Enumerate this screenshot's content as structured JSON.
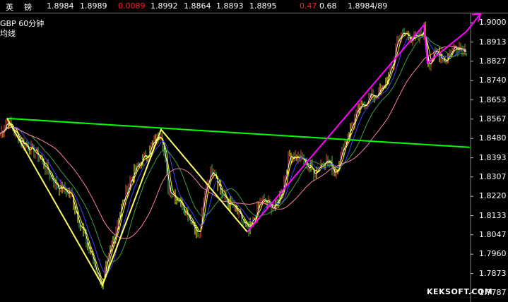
{
  "ticker": {
    "name_1": "英",
    "name_2": "镑",
    "last": "1.8984",
    "ask": "1.8989",
    "change": "0.0089",
    "open": "1.8992",
    "low": "1.8864",
    "prev": "1.8893",
    "high": "1.8895",
    "pct": "0.47",
    "amp": "0.68",
    "bid_ask": "1.8984/89",
    "change_color": "#ff2020",
    "pct_color": "#ff2020"
  },
  "watermark": "KEKSOFT.COM",
  "chart_data": {
    "type": "line",
    "title": "GBP  60分钟",
    "subtitle": "均线",
    "ylim": [
      1.7745,
      1.9045
    ],
    "yticks": [
      "1.9000",
      "1.8913",
      "1.8827",
      "1.8740",
      "1.8653",
      "1.8567",
      "1.8480",
      "1.8393",
      "1.8307",
      "1.8220",
      "1.8133",
      "1.8047",
      "1.7960",
      "1.7873",
      "1.7787"
    ],
    "ytick_values": [
      1.9,
      1.8913,
      1.8827,
      1.874,
      1.8653,
      1.8567,
      1.848,
      1.8393,
      1.8307,
      1.822,
      1.8133,
      1.8047,
      1.796,
      1.7873,
      1.7787
    ],
    "bar_count": 400,
    "price_path": [
      [
        0,
        1.85
      ],
      [
        10,
        1.856
      ],
      [
        30,
        1.847
      ],
      [
        55,
        1.84
      ],
      [
        80,
        1.827
      ],
      [
        100,
        1.823
      ],
      [
        115,
        1.808
      ],
      [
        135,
        1.79
      ],
      [
        145,
        1.782
      ],
      [
        155,
        1.796
      ],
      [
        170,
        1.815
      ],
      [
        185,
        1.83
      ],
      [
        200,
        1.838
      ],
      [
        215,
        1.844
      ],
      [
        228,
        1.852
      ],
      [
        238,
        1.826
      ],
      [
        255,
        1.82
      ],
      [
        270,
        1.812
      ],
      [
        282,
        1.804
      ],
      [
        292,
        1.828
      ],
      [
        302,
        1.835
      ],
      [
        315,
        1.822
      ],
      [
        335,
        1.815
      ],
      [
        352,
        1.806
      ],
      [
        370,
        1.82
      ],
      [
        390,
        1.817
      ],
      [
        400,
        1.826
      ],
      [
        410,
        1.841
      ],
      [
        425,
        1.839
      ],
      [
        445,
        1.833
      ],
      [
        460,
        1.839
      ],
      [
        475,
        1.833
      ],
      [
        490,
        1.848
      ],
      [
        505,
        1.859
      ],
      [
        520,
        1.866
      ],
      [
        540,
        1.869
      ],
      [
        555,
        1.88
      ],
      [
        562,
        1.893
      ],
      [
        575,
        1.895
      ],
      [
        590,
        1.892
      ],
      [
        600,
        1.897
      ],
      [
        605,
        1.882
      ],
      [
        620,
        1.887
      ],
      [
        630,
        1.883
      ],
      [
        645,
        1.89
      ],
      [
        660,
        1.888
      ]
    ],
    "ma_series": [
      {
        "color": "#ffffff",
        "period": 5
      },
      {
        "color": "#ffff00",
        "period": 10
      },
      {
        "color": "#4040ff",
        "period": 20
      },
      {
        "color": "#40a040",
        "period": 40
      },
      {
        "color": "#ff80a0",
        "period": 80
      }
    ],
    "annotations": {
      "green_trendline": {
        "color": "#00ff00",
        "points": [
          [
            10,
            1.857
          ],
          [
            665,
            1.844
          ]
        ]
      },
      "yellow_lines": {
        "color": "#ffff60",
        "points": [
          [
            10,
            1.857
          ],
          [
            145,
            1.782
          ],
          [
            228,
            1.852
          ],
          [
            350,
            1.806
          ]
        ]
      },
      "magenta_lines": {
        "color": "#ff00ff",
        "points": [
          [
            350,
            1.806
          ],
          [
            600,
            1.899
          ],
          [
            605,
            1.882
          ],
          [
            660,
            1.896
          ]
        ]
      },
      "magenta_arrow": {
        "color": "#ff00ff",
        "points": [
          [
            660,
            1.896
          ],
          [
            680,
            1.904
          ]
        ]
      }
    }
  }
}
